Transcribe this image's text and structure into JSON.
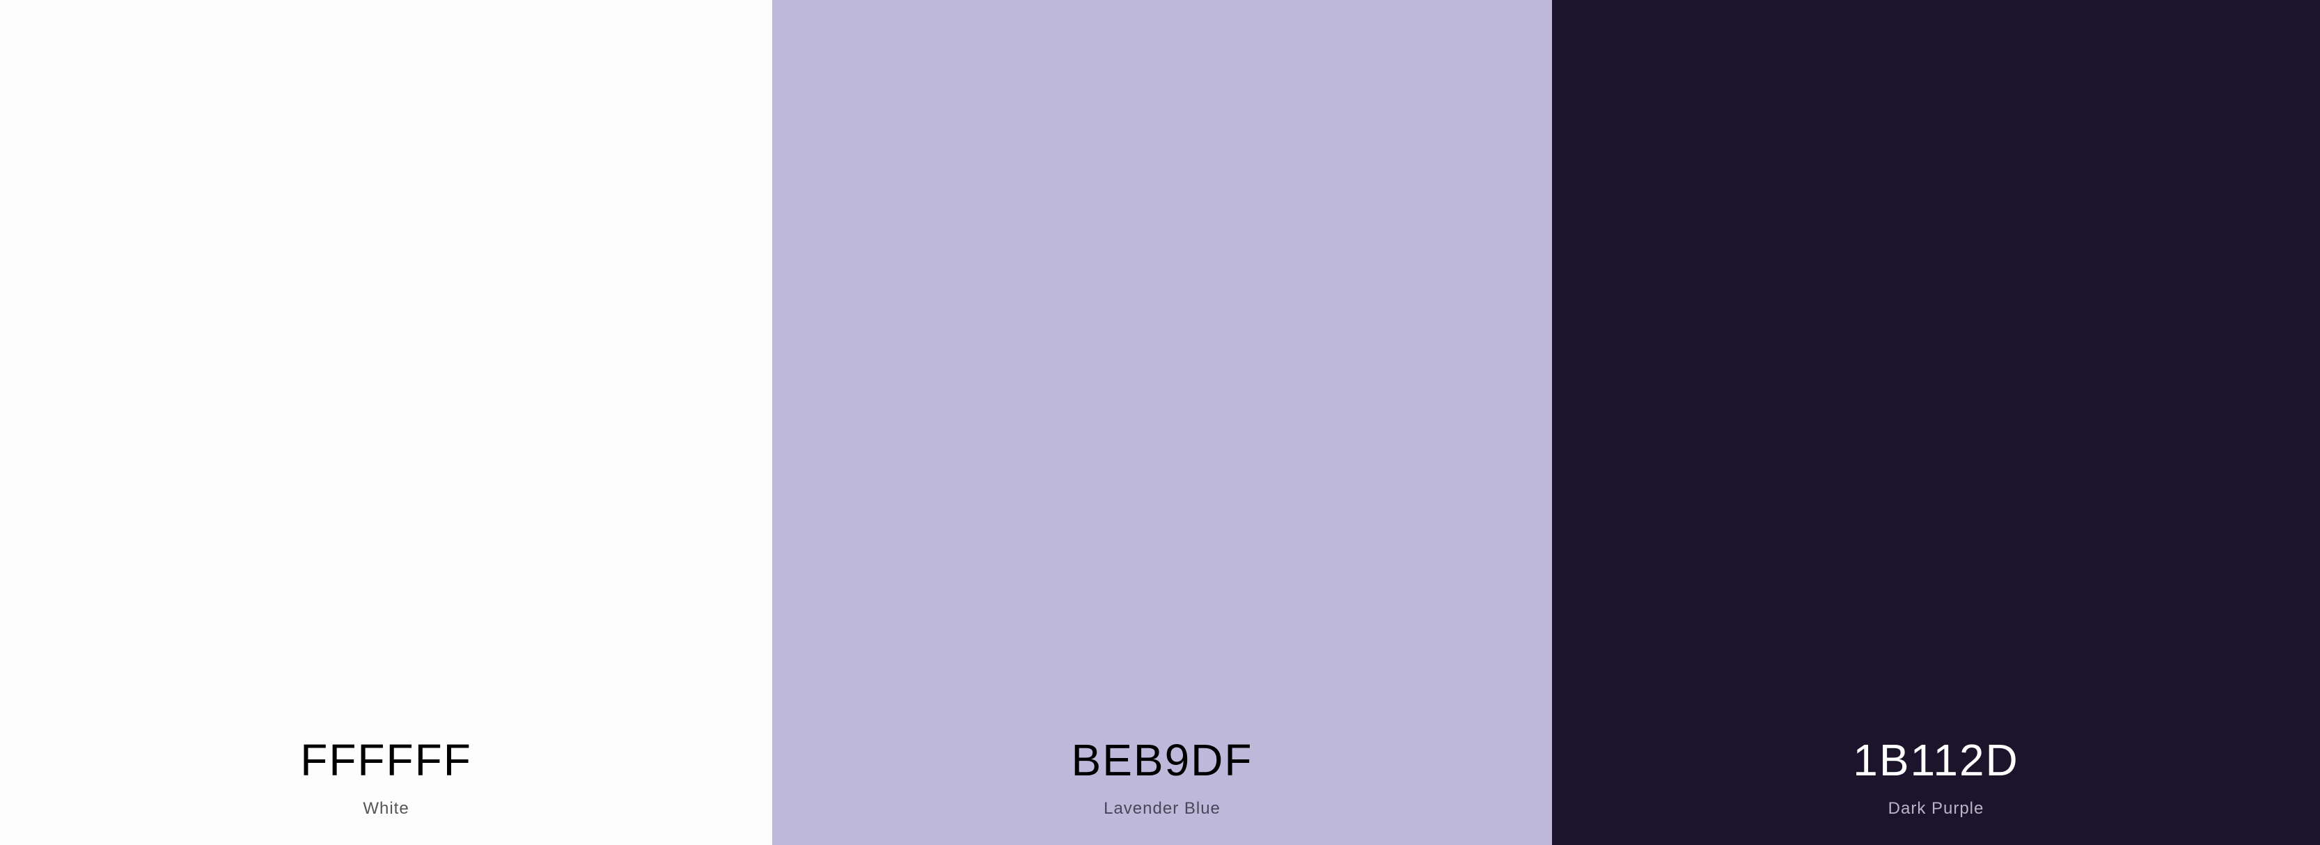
{
  "swatches": [
    {
      "hex": "FFFFFF",
      "name": "White",
      "color": "#FDFDFD",
      "hex_text_color": "#000000",
      "name_text_color": "#555555"
    },
    {
      "hex": "BEB9DF",
      "name": "Lavender Blue",
      "color": "#BEB9DB",
      "hex_text_color": "#000000",
      "name_text_color": "#4A4658"
    },
    {
      "hex": "1B112D",
      "name": "Dark Purple",
      "color": "#1B142A",
      "hex_text_color": "#FFFFFF",
      "name_text_color": "#B9B4C8"
    }
  ]
}
